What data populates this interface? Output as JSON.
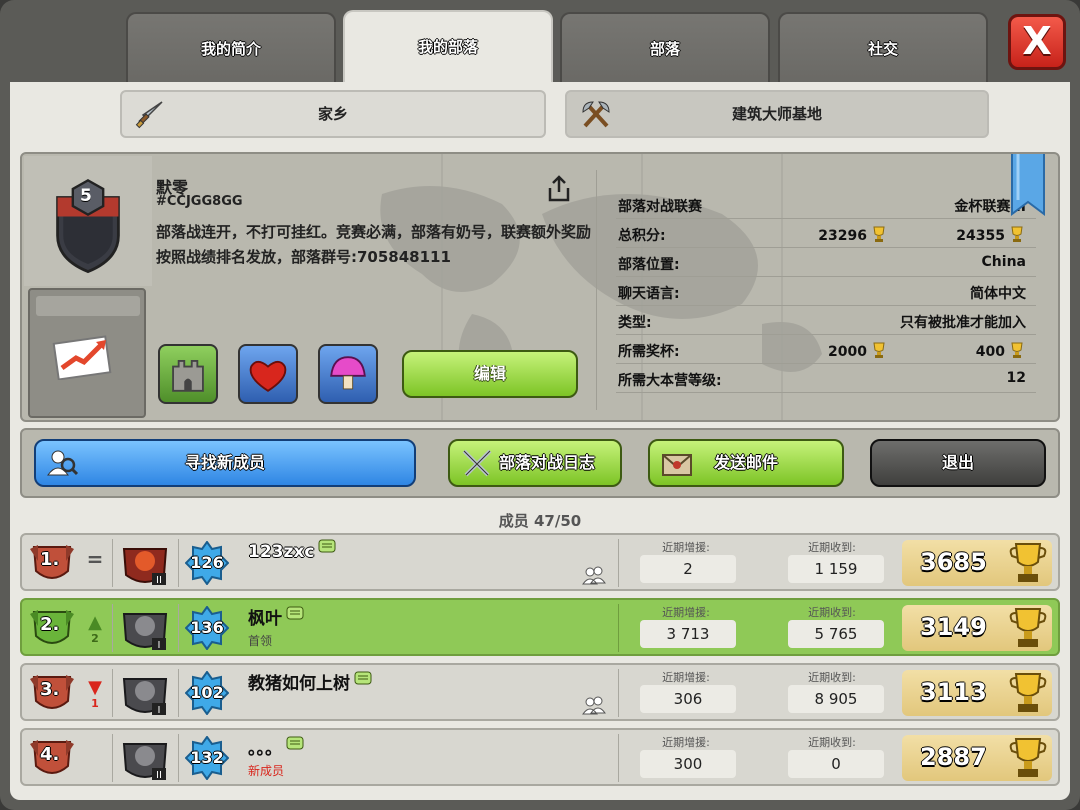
{
  "tabs": [
    "我的简介",
    "我的部落",
    "部落",
    "社交"
  ],
  "close_label": "X",
  "subtabs": {
    "home": "家乡",
    "builder": "建筑大师基地"
  },
  "clan": {
    "level": "5",
    "name": "默零",
    "tag": "#CCJGG8GG",
    "description": "部落战连开，不打可挂红。竞赛必满，部落有奶号，联赛额外奖励按照战绩排名发放，部落群号:705848111",
    "edit_label": "编辑"
  },
  "stats": {
    "war_league_label": "部落对战联赛",
    "war_league_value": "金杯联赛III",
    "total_points_label": "总积分:",
    "total_points_home": "23296",
    "total_points_builder": "24355",
    "location_label": "部落位置:",
    "location_value": "China",
    "language_label": "聊天语言:",
    "language_value": "简体中文",
    "type_label": "类型:",
    "type_value": "只有被批准才能加入",
    "required_trophies_label": "所需奖杯:",
    "required_trophies_home": "2000",
    "required_trophies_builder": "400",
    "required_th_label": "所需大本营等级:",
    "required_th_value": "12"
  },
  "actions": {
    "find": "寻找新成员",
    "warlog": "部落对战日志",
    "mail": "发送邮件",
    "leave": "退出"
  },
  "members_title": "成员 47/50",
  "donated_label": "近期增援:",
  "received_label": "近期收到:",
  "members": [
    {
      "rank": "1.",
      "change": "=",
      "change_num": "",
      "level": "126",
      "name": "123zxc",
      "role": "",
      "donated": "2",
      "received": "1 159",
      "trophies": "3685"
    },
    {
      "rank": "2.",
      "change": "▲",
      "change_num": "2",
      "level": "136",
      "name": "枫叶",
      "role": "首领",
      "donated": "3 713",
      "received": "5 765",
      "trophies": "3149"
    },
    {
      "rank": "3.",
      "change": "▼",
      "change_num": "1",
      "level": "102",
      "name": "教猪如何上树",
      "role": "",
      "donated": "306",
      "received": "8 905",
      "trophies": "3113"
    },
    {
      "rank": "4.",
      "change": "",
      "change_num": "",
      "level": "132",
      "name": "。。。",
      "role": "新成员",
      "donated": "300",
      "received": "0",
      "trophies": "2887"
    }
  ],
  "colors": {
    "accent_green": "#7dc426",
    "accent_blue": "#2f86e4",
    "close_red": "#c7221a",
    "new_member_red": "#d9261c"
  }
}
